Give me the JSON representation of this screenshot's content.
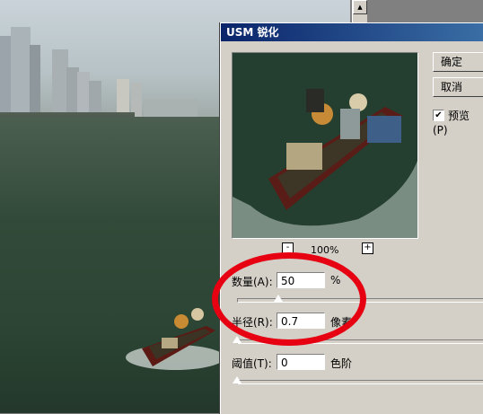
{
  "dialog": {
    "title": "USM 锐化",
    "ok_label": "确定",
    "cancel_label": "取消",
    "preview_label": "预览(P)",
    "preview_checked": true,
    "zoom_minus": "-",
    "zoom_plus": "+",
    "zoom_level": "100%",
    "amount": {
      "label": "数量(A):",
      "value": "50",
      "unit": "%",
      "slider_fraction": 0.165
    },
    "radius": {
      "label": "半径(R):",
      "value": "0.7",
      "unit": "像素",
      "slider_fraction": 0.0
    },
    "threshold": {
      "label": "阈值(T):",
      "value": "0",
      "unit": "色阶",
      "slider_fraction": 0.0
    }
  },
  "icons": {
    "scroll_up": "scroll-up-icon",
    "scroll_down": "scroll-down-icon"
  },
  "colors": {
    "annotation": "#e60012",
    "titlebar_start": "#0a246a",
    "titlebar_end": "#3a6ea5"
  }
}
